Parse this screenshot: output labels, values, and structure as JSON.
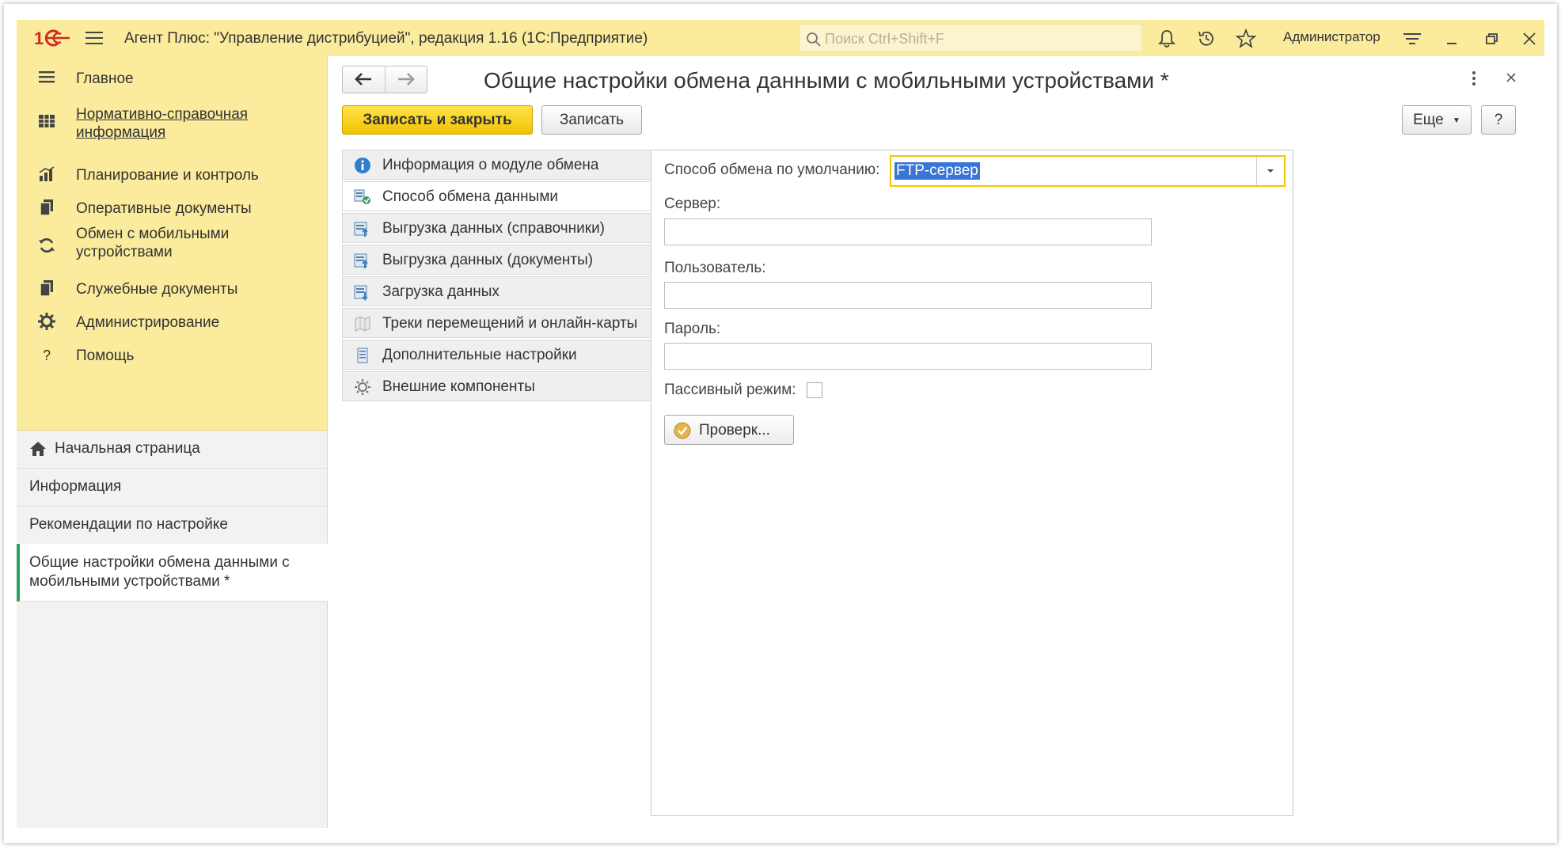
{
  "app": {
    "title": "Агент Плюс: \"Управление дистрибуцией\", редакция 1.16  (1С:Предприятие)",
    "search_placeholder": "Поиск Ctrl+Shift+F",
    "username": "Администратор"
  },
  "sidebar": {
    "menu": [
      {
        "label": "Главное",
        "icon": "list-icon"
      },
      {
        "label": "Нормативно-справочная информация",
        "icon": "grid-icon"
      },
      {
        "label": "Планирование и контроль",
        "icon": "bar-chart-icon"
      },
      {
        "label": "Оперативные документы",
        "icon": "documents-icon"
      },
      {
        "label": "Обмен с мобильными устройствами",
        "icon": "sync-icon"
      },
      {
        "label": "Служебные документы",
        "icon": "documents-icon"
      },
      {
        "label": "Администрирование",
        "icon": "gear-icon"
      },
      {
        "label": "Помощь",
        "icon": "question-icon"
      }
    ],
    "open_windows": [
      {
        "label": "Начальная страница"
      },
      {
        "label": "Информация"
      },
      {
        "label": "Рекомендации по настройке"
      },
      {
        "label": "Общие настройки обмена данными с мобильными устройствами *"
      }
    ]
  },
  "form": {
    "title": "Общие настройки обмена данными с мобильными устройствами *",
    "save_close_label": "Записать и закрыть",
    "save_label": "Записать",
    "more_label": "Еще",
    "help_label": "?",
    "tabs": [
      {
        "label": "Информация о модуле обмена",
        "icon": "info-icon"
      },
      {
        "label": "Способ обмена данными",
        "icon": "exchange-icon"
      },
      {
        "label": "Выгрузка данных (справочники)",
        "icon": "upload-icon"
      },
      {
        "label": "Выгрузка данных (документы)",
        "icon": "upload-icon"
      },
      {
        "label": "Загрузка данных",
        "icon": "download-icon"
      },
      {
        "label": "Треки перемещений и онлайн-карты",
        "icon": "map-icon"
      },
      {
        "label": "Дополнительные настройки",
        "icon": "settings-list-icon"
      },
      {
        "label": "Внешние компоненты",
        "icon": "gear-icon"
      }
    ],
    "active_tab": 1,
    "fields": {
      "default_method_label": "Способ обмена по умолчанию:",
      "default_method_value": "FTP-сервер",
      "server_label": "Сервер:",
      "server_value": "",
      "user_label": "Пользователь:",
      "user_value": "",
      "password_label": "Пароль:",
      "password_value": "",
      "passive_label": "Пассивный режим:",
      "passive_checked": false,
      "check_button_label": "Проверк..."
    }
  },
  "colors": {
    "header_yellow": "#fbeb9c",
    "primary_button": "#f2c200",
    "active_marker": "#2d9f5f",
    "selection": "#3875d7"
  }
}
